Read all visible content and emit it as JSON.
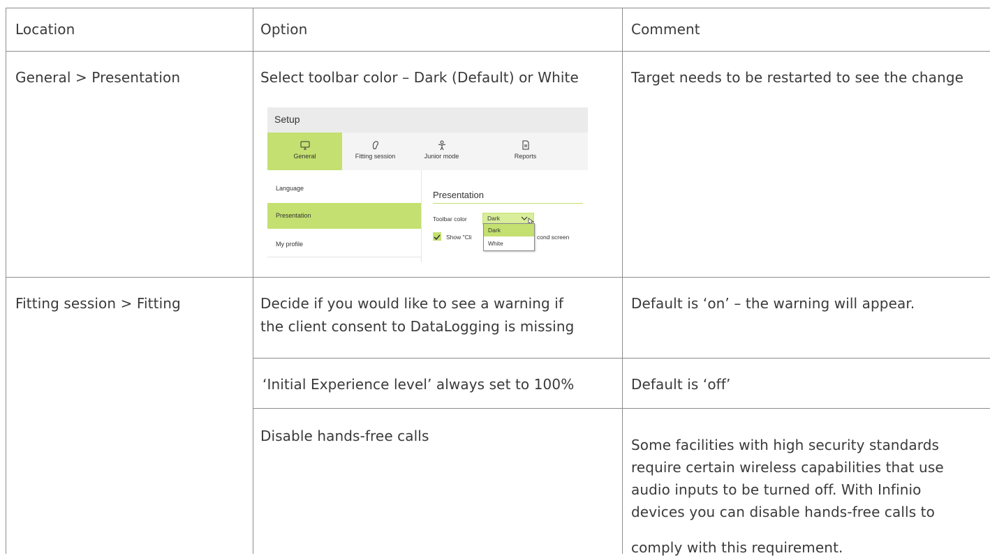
{
  "table": {
    "headers": [
      "Location",
      "Option",
      "Comment"
    ],
    "rows": [
      {
        "location": "General > Presentation",
        "option": "Select toolbar color – Dark (Default) or White",
        "comment": "Target needs to be restarted to see the change"
      },
      {
        "location": "Fitting session > Fitting",
        "option_line1": "Decide if you would like to see a warning if",
        "option_line2": "the client consent to DataLogging is missing",
        "comment": "Default is ‘on’ – the warning will appear."
      },
      {
        "option": "‘Initial Experience level’ always set to 100%",
        "comment": "Default is ‘off’"
      },
      {
        "option": "Disable hands-free calls",
        "comment_lines": [
          "Some facilities with high security standards",
          "require certain wireless capabilities that use",
          "audio inputs to be turned off. With Infinio",
          "devices you can disable hands-free calls to",
          "comply with this requirement."
        ]
      }
    ]
  },
  "screenshot": {
    "title": "Setup",
    "tabs": [
      {
        "label": "General",
        "icon": "monitor-icon"
      },
      {
        "label": "Fitting session",
        "icon": "ear-icon"
      },
      {
        "label": "Junior mode",
        "icon": "child-icon"
      },
      {
        "label": "Reports",
        "icon": "document-icon"
      }
    ],
    "sidebar": [
      "Language",
      "Presentation",
      "My profile"
    ],
    "section_title": "Presentation",
    "toolbar_label": "Toolbar color",
    "toolbar_value": "Dark",
    "dropdown_options": [
      "Dark",
      "White"
    ],
    "show_text": "Show \"Cli",
    "second_screen_text": "cond screen"
  },
  "colors": {
    "accent_green": "#c4e070",
    "border": "#8c8c8c"
  }
}
